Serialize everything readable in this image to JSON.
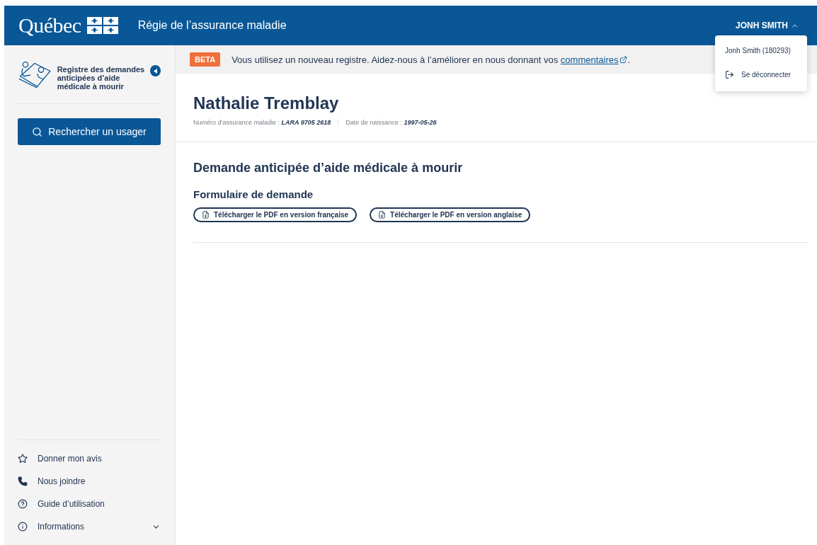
{
  "header": {
    "logo": "Québec",
    "title": "Régie de l’assurance maladie",
    "user": {
      "label": "JONH SMITH",
      "expanded": true,
      "menu": [
        {
          "kind": "info",
          "label": "Jonh Smith (180293)"
        },
        {
          "kind": "logout",
          "label": "Se déconnecter"
        }
      ]
    }
  },
  "sidebar": {
    "app_title": "Registre des demandes anticipées d’aide médicale à mourir",
    "search_button": "Rechercher un usager",
    "footer_items": [
      {
        "kind": "star",
        "label": "Donner mon avis"
      },
      {
        "kind": "phone",
        "label": "Nous joindre"
      },
      {
        "kind": "help",
        "label": "Guide d’utilisation"
      },
      {
        "kind": "info",
        "label": "Informations",
        "expanded": false
      }
    ]
  },
  "banner": {
    "badge": "BETA",
    "text": "Vous utilisez un nouveau registre. Aidez-nous à l’améliorer en nous donnant vos",
    "link": "commentaires",
    "suffix": "."
  },
  "patient": {
    "name": "Nathalie Tremblay",
    "fields": [
      {
        "label": "Numéro d’assurance maladie :",
        "value": "LARA 9705 2618"
      },
      {
        "label": "Date de naissance :",
        "value": "1997-05-26"
      }
    ]
  },
  "section": {
    "title": "Demande anticipée d’aide médicale à mourir",
    "subtitle": "Formulaire de demande",
    "buttons": [
      "Télécharger le PDF en version française",
      "Télécharger le PDF en version anglaise"
    ]
  }
}
